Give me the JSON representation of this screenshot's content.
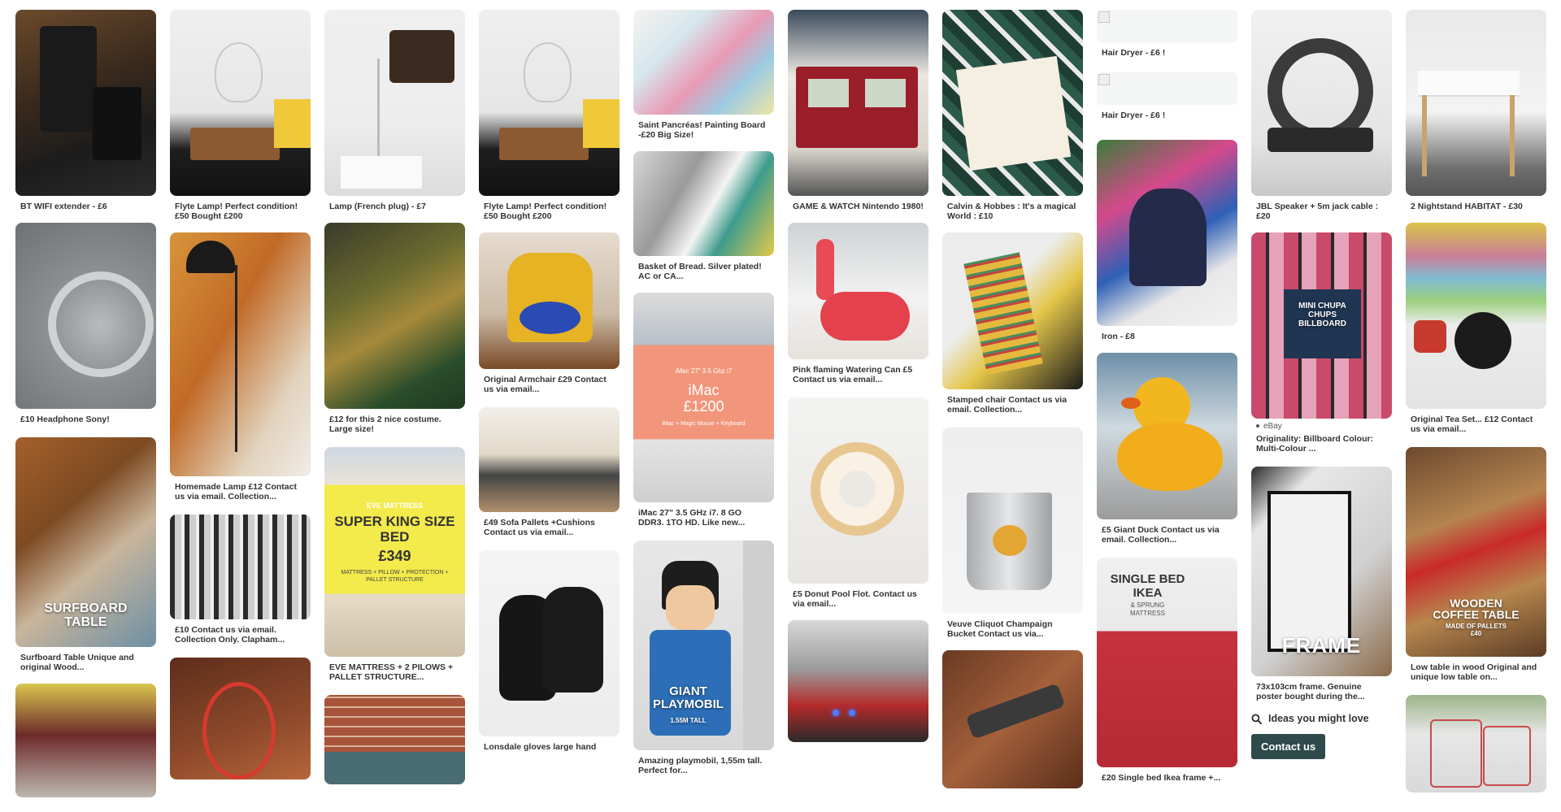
{
  "cols": [
    {
      "pins": [
        {
          "caption": "BT WIFI extender - £6"
        },
        {
          "caption": "£10 Headphone Sony!"
        },
        {
          "caption": "Surfboard Table Unique and original Wood...",
          "overlay": "SURFBOARD\nTABLE"
        },
        {
          "caption": ""
        }
      ]
    },
    {
      "pins": [
        {
          "caption": "Flyte Lamp! Perfect condition! £50 Bought £200"
        },
        {
          "caption": "Homemade Lamp £12 Contact us via email. Collection..."
        },
        {
          "caption": "£10 Contact us via email. Collection Only. Clapham..."
        },
        {
          "caption": ""
        }
      ]
    },
    {
      "pins": [
        {
          "caption": "Lamp (French plug) - £7"
        },
        {
          "caption": "£12 for this 2 nice costume. Large size!"
        },
        {
          "caption": "EVE MATTRESS + 2 PILOWS + PALLET STRUCTURE...",
          "ad_kicker": "EVE MATTRESS",
          "ad_title": "SUPER KING SIZE BED",
          "ad_price": "£349",
          "ad_sub": "MATTRESS + PILLOW + PROTECTION + PALLET STRUCTURE"
        },
        {
          "caption": ""
        }
      ]
    },
    {
      "pins": [
        {
          "caption": "Flyte Lamp! Perfect condition! £50 Bought £200"
        },
        {
          "caption": "Original Armchair £29 Contact us via email..."
        },
        {
          "caption": "£49 Sofa Pallets +Cushions Contact us via email..."
        },
        {
          "caption": "Lonsdale gloves large hand"
        }
      ]
    },
    {
      "pins": [
        {
          "caption": "Saint Pancréas! Painting Board -£20 Big Size!"
        },
        {
          "caption": "Basket of Bread. Silver plated! AC or CA..."
        },
        {
          "caption": "iMac 27\" 3.5 GHz i7. 8 GO DDR3. 1TO HD. Like new...",
          "ad_spec": "iMac 27\" 3.5 Ghz i7",
          "ad_title": "iMac",
          "ad_price": "£1200",
          "ad_sub": "iMac + Magic Mouse + Keyboard"
        },
        {
          "caption": "Amazing playmobil, 1,55m tall. Perfect for...",
          "overlay": "GIANT\nPLAYMOBIL",
          "overlay_sub": "1.55M TALL"
        }
      ]
    },
    {
      "pins": [
        {
          "caption": "GAME & WATCH Nintendo 1980!"
        },
        {
          "caption": "Pink flaming Watering Can £5 Contact us via email..."
        },
        {
          "caption": "£5 Donut Pool Flot. Contact us via email..."
        },
        {
          "caption": ""
        }
      ]
    },
    {
      "pins": [
        {
          "caption": "Calvin & Hobbes : It's a magical World : £10"
        },
        {
          "caption": "Stamped chair Contact us via email. Collection..."
        },
        {
          "caption": "Veuve Cliquot Champaign Bucket Contact us via..."
        },
        {
          "caption": ""
        }
      ]
    },
    {
      "pins": [
        {
          "caption": "Hair Dryer - £6 !"
        },
        {
          "caption": "Hair Dryer - £6 !"
        },
        {
          "caption": "Iron - £8"
        },
        {
          "caption": "£5 Giant Duck Contact us via email. Collection..."
        },
        {
          "caption": "£20 Single bed Ikea frame +...",
          "ad_title": "SINGLE BED\nIKEA",
          "ad_sub": "& SPRUNG\nMATTRESS"
        }
      ]
    },
    {
      "pins": [
        {
          "caption": "JBL Speaker + 5m jack cable : £20"
        },
        {
          "caption": "Originality: Billboard Colour: Multi-Colour ...",
          "source": "eBay",
          "overlay": "MINI CHUPA\nCHUPS\nBILLBOARD"
        },
        {
          "caption": "73x103cm frame. Genuine poster bought during the...",
          "overlay": "FRAME"
        }
      ],
      "related_label": "Ideas you might love",
      "contact_label": "Contact us"
    },
    {
      "pins": [
        {
          "caption": "2 Nightstand HABITAT - £30"
        },
        {
          "caption": "Original Tea Set... £12 Contact us via email..."
        },
        {
          "caption": "Low table in wood Original and unique low table on...",
          "overlay": "WOODEN\nCOFFEE TABLE",
          "overlay_sub": "MADE OF PALLETS\n£40"
        },
        {
          "caption": ""
        }
      ]
    }
  ]
}
